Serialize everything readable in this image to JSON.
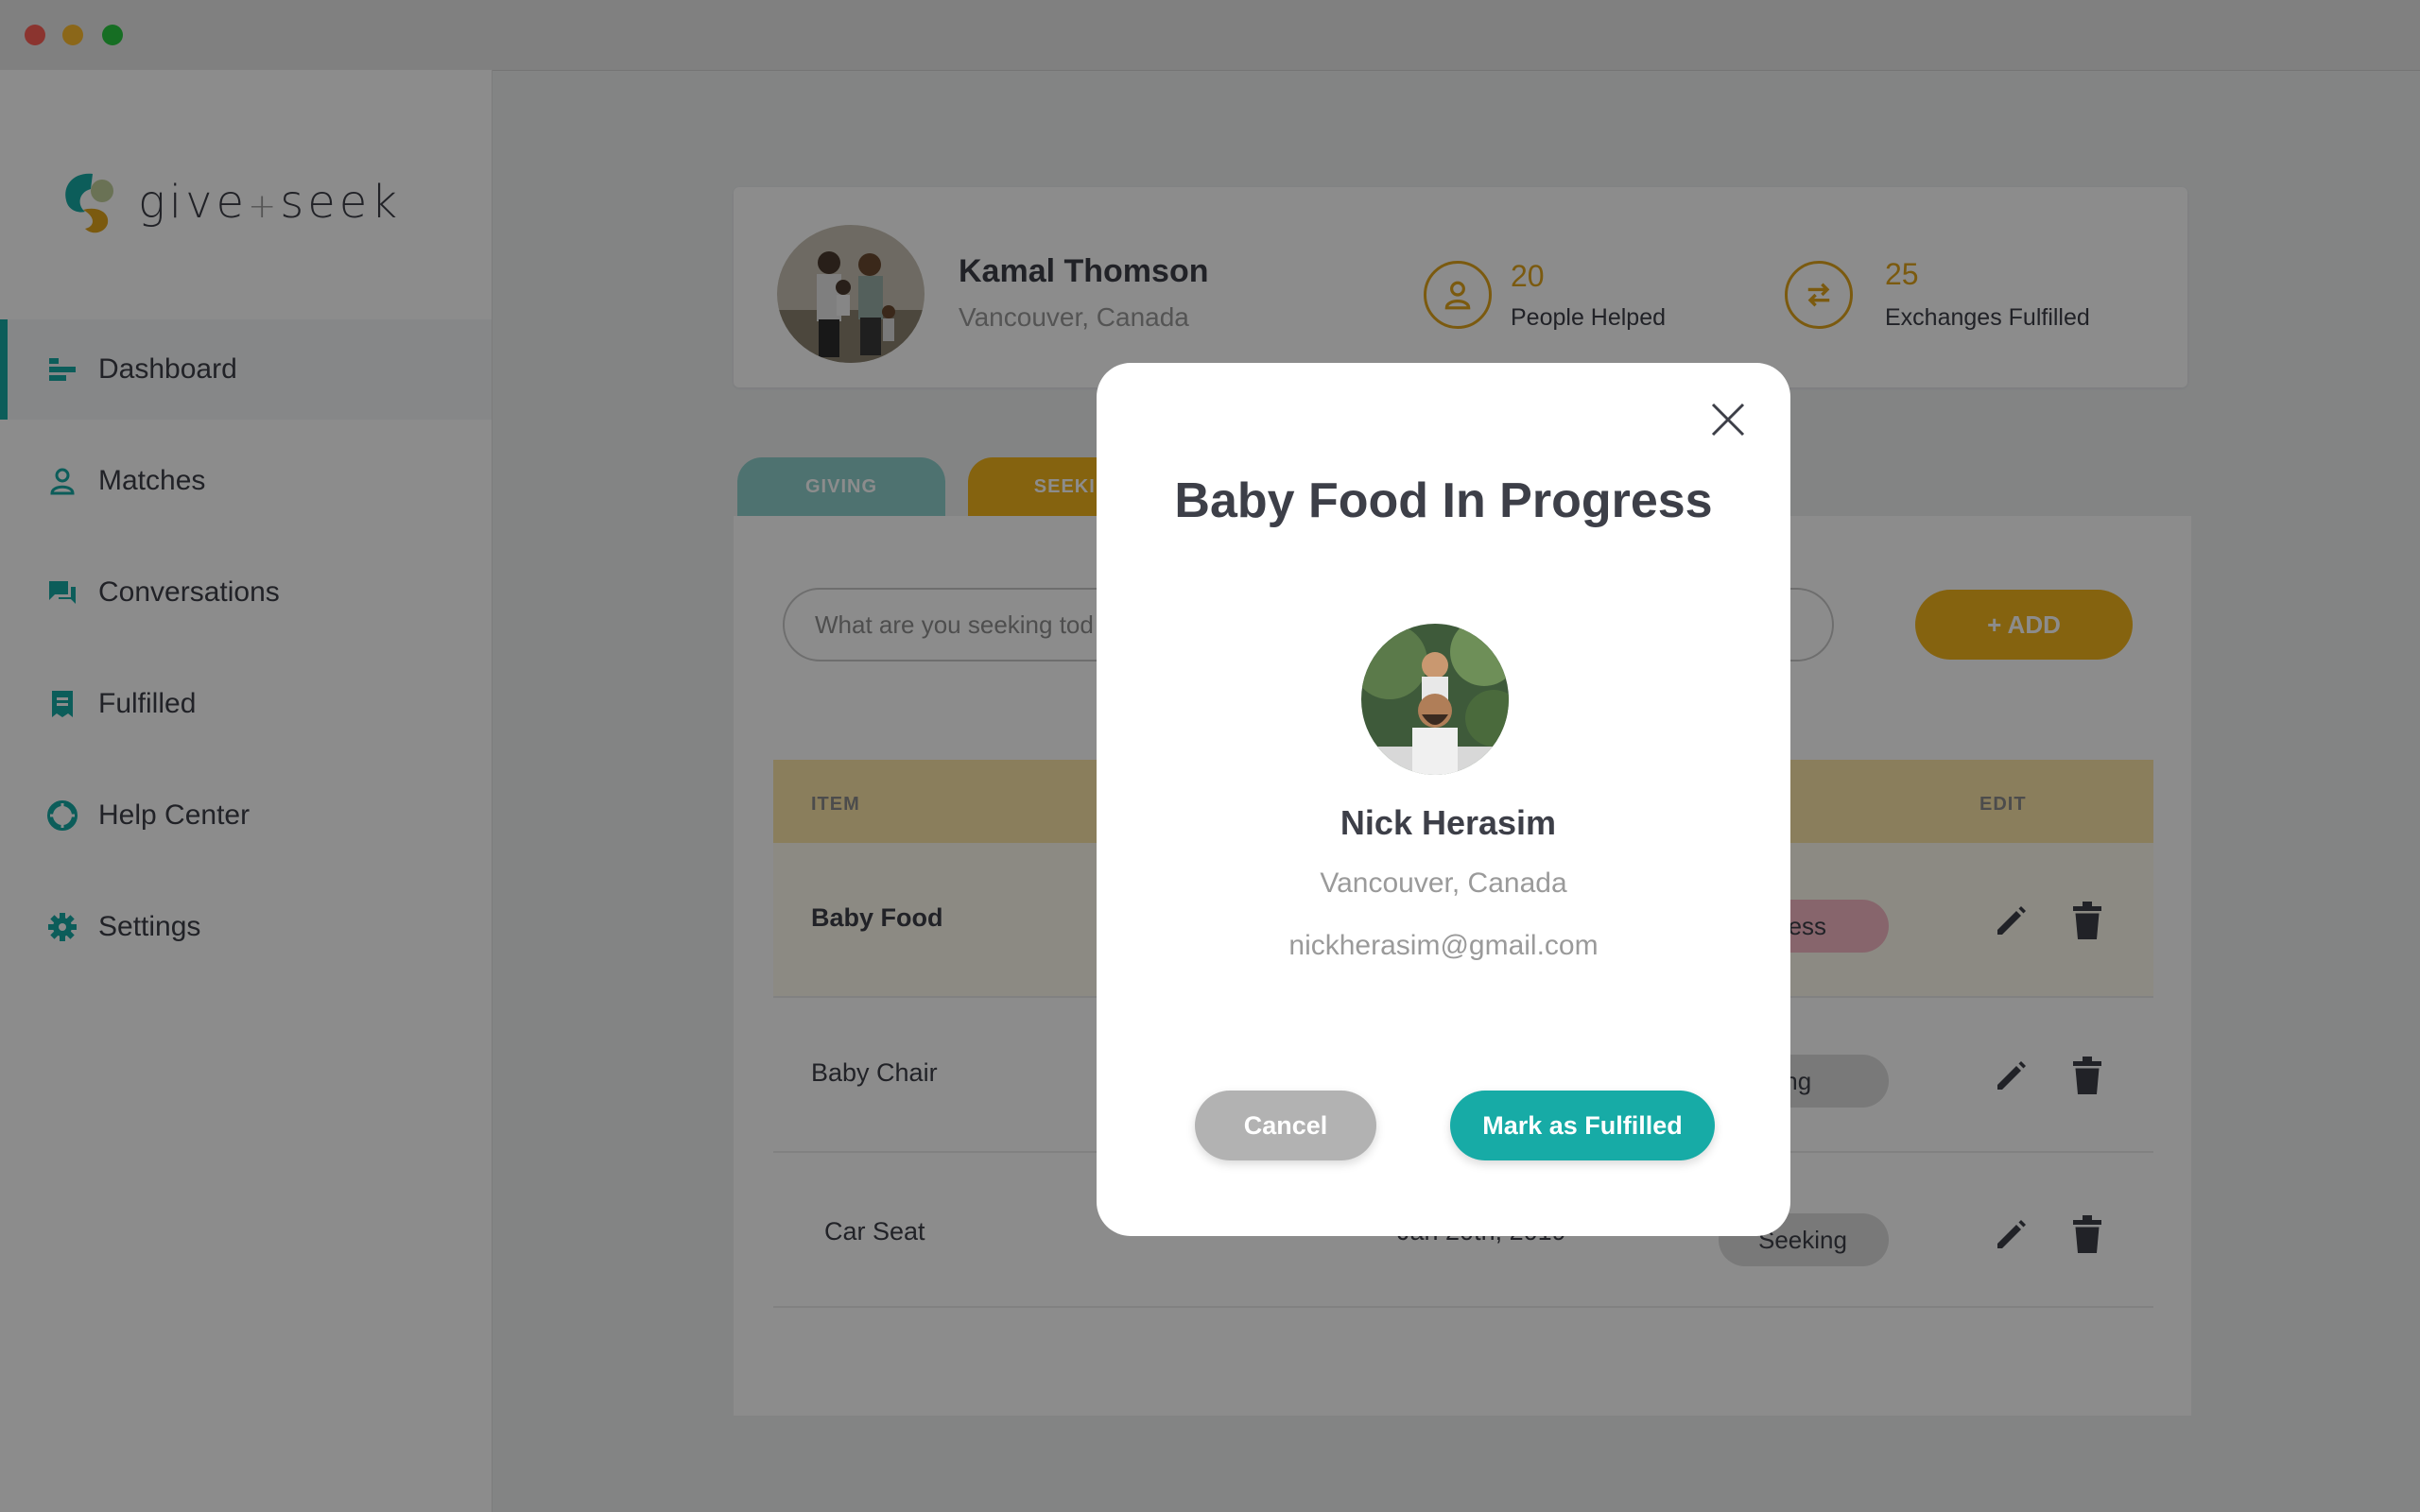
{
  "app": {
    "logo_text": "give",
    "logo_plus": "+",
    "logo_text2": "seek"
  },
  "colors": {
    "teal": "#17a9a4",
    "gold": "#e1a51c",
    "pink": "#f6b8c5",
    "overlay": "rgba(0,0,0,0.45)"
  },
  "sidebar": {
    "items": [
      {
        "label": "Dashboard",
        "icon": "dashboard-icon",
        "active": true
      },
      {
        "label": "Matches",
        "icon": "person-icon",
        "active": false
      },
      {
        "label": "Conversations",
        "icon": "chat-icon",
        "active": false
      },
      {
        "label": "Fulfilled",
        "icon": "receipt-icon",
        "active": false
      },
      {
        "label": "Help Center",
        "icon": "lifebuoy-icon",
        "active": false
      },
      {
        "label": "Settings",
        "icon": "gear-icon",
        "active": false
      }
    ]
  },
  "profile": {
    "name": "Kamal Thomson",
    "location": "Vancouver, Canada",
    "stats": [
      {
        "value": "20",
        "label": "People Helped",
        "icon": "person-icon"
      },
      {
        "value": "25",
        "label": "Exchanges Fulfilled",
        "icon": "exchange-icon"
      }
    ]
  },
  "tabs": {
    "giving": "GIVING",
    "seeking": "SEEKIN"
  },
  "search": {
    "placeholder": "What are you seeking tod"
  },
  "add_button": "+ ADD",
  "table": {
    "headers": {
      "item": "ITEM",
      "edit": "EDIT"
    },
    "rows": [
      {
        "item": "Baby Food",
        "date": "",
        "status": "ogress"
      },
      {
        "item": "Baby Chair",
        "date": "",
        "status": "eking"
      },
      {
        "item": "Car Seat",
        "date": "Jan 20th, 2019",
        "status": "Seeking"
      }
    ]
  },
  "modal": {
    "title": "Baby Food In Progress",
    "name": "Nick Herasim",
    "location": "Vancouver, Canada",
    "email": "nickherasim@gmail.com",
    "cancel": "Cancel",
    "confirm": "Mark as Fulfilled"
  }
}
